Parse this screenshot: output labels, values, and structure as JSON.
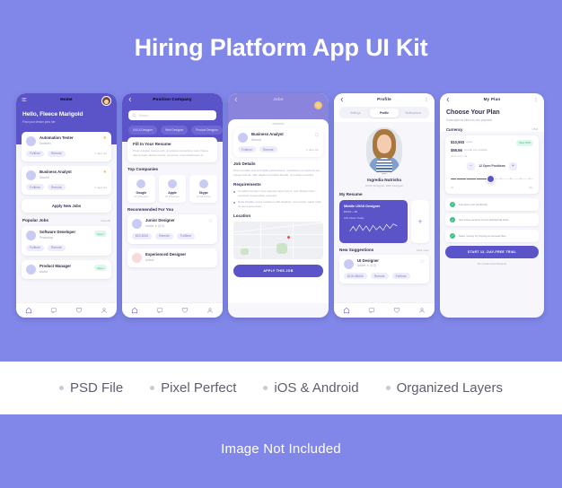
{
  "hero": {
    "title": "Hiring Platform App UI Kit"
  },
  "footer": {
    "note": "Image Not Included"
  },
  "features": [
    {
      "label": "PSD File"
    },
    {
      "label": "Pixel Perfect"
    },
    {
      "label": "iOS & Android"
    },
    {
      "label": "Organized Layers"
    }
  ],
  "bottom_nav": [
    {
      "icon": "home-icon",
      "label": "Home"
    },
    {
      "icon": "chat-icon",
      "label": "Chat"
    },
    {
      "icon": "heart-icon",
      "label": "Saved"
    },
    {
      "icon": "person-icon",
      "label": "Profile"
    }
  ],
  "screen1": {
    "header": {
      "title": "Home",
      "menu_icon": "menu-icon",
      "avatar": "user-avatar"
    },
    "greeting": "Hello, Fleece Marigold",
    "subtitle": "Find your dream jobs her",
    "jobs": [
      {
        "title": "Automation Tester",
        "company": "Ennbbler",
        "tags": [
          "Fulltime",
          "Remote"
        ],
        "days": "7 days left",
        "starred": "star-icon"
      },
      {
        "title": "Business Analyst",
        "company": "Discord",
        "tags": [
          "Fulltime",
          "Remote"
        ],
        "days": "5 days left",
        "starred": "star-icon"
      }
    ],
    "apply_button": "Apply New Jobs",
    "popular": {
      "title": "Popular Jobs",
      "view_all": "View All"
    },
    "popular_jobs": [
      {
        "title": "Software Developer",
        "company": "Photoshop",
        "badge": "Open",
        "tags": [
          "Fulltime",
          "Remote"
        ]
      },
      {
        "title": "Product Manager",
        "company": "Adobe",
        "badge": "Open",
        "tags": [
          "Fulltime",
          "Remote"
        ]
      }
    ]
  },
  "screen2": {
    "header": {
      "title": "Position Company",
      "back_icon": "back-arrow-icon"
    },
    "search": {
      "placeholder": "Search",
      "icon": "search-icon"
    },
    "categories": [
      "UX/UI Designer",
      "Web Designer",
      "Product Designer"
    ],
    "resume": {
      "title": "Fill In Your Resume",
      "body": "Proin volutpat massa erat, ut tempus consectetur quis. Donec ullamcorper ultrices metus, vel auctor urna scelerisque et."
    },
    "top_companies": {
      "title": "Top Companies"
    },
    "companies": [
      {
        "name": "Google",
        "meta": "32 Vacancies"
      },
      {
        "name": "Apple",
        "meta": "20 Vacancies"
      },
      {
        "name": "Skype",
        "meta": "12 Vacancies"
      }
    ],
    "recommended": {
      "title": "Recommended For You"
    },
    "recommended_jobs": [
      {
        "title": "Junior Designer",
        "company": "Adobe",
        "rating": "(5.0)",
        "tags": [
          "$20-$240",
          "Remote",
          "Fulltime"
        ],
        "save_icon": "heart-outline-icon"
      },
      {
        "title": "Experienced Designer",
        "company": "Airbnb",
        "tags": []
      }
    ]
  },
  "screen3": {
    "header": {
      "back_icon": "back-arrow-icon",
      "title": "Jobs",
      "sun_icon": "sun-icon"
    },
    "job": {
      "title": "Business Analyst",
      "company": "Discord",
      "tags": [
        "Fulltime",
        "Remote"
      ],
      "days": "5 days left",
      "bookmark_icon": "bookmark-icon"
    },
    "details": {
      "title": "Job Details",
      "body": "Duis convallis erat id fringilla pellentesque. Vestibulum at maximus est. Integer lacinia, nibh dapibus tincidunt blandit, orci sapien suscipit."
    },
    "requirements": {
      "title": "Requirements",
      "items": [
        "Curabitur semper risus egestas turpis luctus, sed ultricies risus hendrerit suspendisse praesent.",
        "Nulla fringilla, purus sodales mollis dapibus, nunc turpis mattis nulla, sit amet accumsan."
      ]
    },
    "location": {
      "title": "Location",
      "pin_icon": "map-pin-icon"
    },
    "cta": "APPLY THIS JOB"
  },
  "screen4": {
    "header": {
      "back_icon": "back-arrow-icon",
      "title": "Profile",
      "more_icon": "more-vertical-icon"
    },
    "tabs": [
      {
        "label": "Settings",
        "active": false
      },
      {
        "label": "Profile",
        "active": true
      },
      {
        "label": "Notifications",
        "active": false
      }
    ],
    "profile": {
      "name": "Ingredia Nutrisha",
      "role": "UX/UI Designer, Web Designer",
      "photo": "profile-photo"
    },
    "resume": {
      "section_title": "My Resume",
      "card_title": "Middle UX/UI Designer",
      "price": "$4529 + 80",
      "views": "129 Views Today",
      "add_icon": "plus-icon",
      "chart": "line-chart"
    },
    "suggestions": {
      "title": "New Suggestions",
      "find_more": "Find more"
    },
    "suggestion_jobs": [
      {
        "title": "UI Designer",
        "company": "Adobe",
        "rating": "(5.0)",
        "tags": [
          "$100-$500k",
          "Remote",
          "Fulltime"
        ],
        "save_icon": "heart-outline-icon"
      }
    ]
  },
  "screen5": {
    "header": {
      "back_icon": "back-arrow-icon",
      "title": "My Plan",
      "more_icon": "more-vertical-icon"
    },
    "heading": "Choose Your Plan",
    "subheading": "Subscriptions billed as one payment",
    "currency": {
      "label": "Currency",
      "value": "USD"
    },
    "pricing": {
      "annual": "$10,903",
      "annual_period": "/year",
      "monthly": "$55.56",
      "monthly_period": "/month per position",
      "note": "price excl. vat",
      "save_badge": "Save 20%"
    },
    "stepper": {
      "minus": "−",
      "plus": "+",
      "label": "12 Open Positions"
    },
    "slider": {
      "min": "10",
      "max": "50+",
      "value": "12"
    },
    "features": [
      "List open (12 positions)",
      "Get a free access to our behavioral tests",
      "Save money by buying an annual plan"
    ],
    "cta": "START 12- DAY-FREE TRIAL",
    "cta_note": "No Credit Card Reqired"
  }
}
